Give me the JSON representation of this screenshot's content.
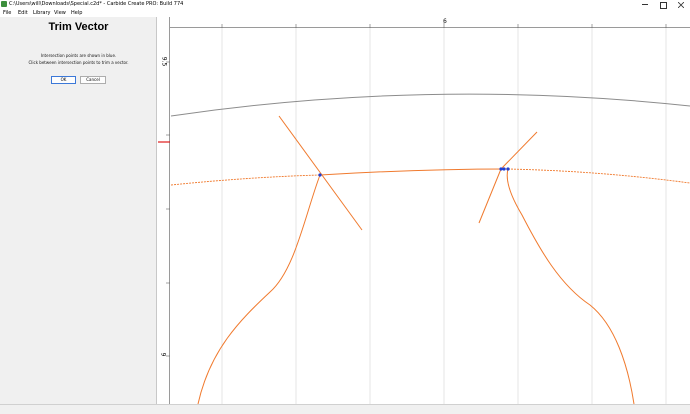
{
  "window": {
    "title": "C:\\Users\\will\\Downloads\\Special.c2d* - Carbide Create PRO: Build 774"
  },
  "menu": [
    "File",
    "Edit",
    "Library",
    "View",
    "Help"
  ],
  "panel": {
    "title": "Trim Vector",
    "line1": "Intersection points are shown in blue.",
    "line2": "Click between intersection points to trim a vector.",
    "ok_label": "OK",
    "cancel_label": "Cancel"
  },
  "rulers": {
    "top_label": "6",
    "left_label_1": "9.5",
    "left_label_2": "9"
  },
  "colors": {
    "vector": "#f07a2e",
    "arc_gray": "#8c8c8c",
    "grid": "#d4d4d4",
    "intersection": "#1f3fd6",
    "marker_red": "#e01b1b"
  }
}
